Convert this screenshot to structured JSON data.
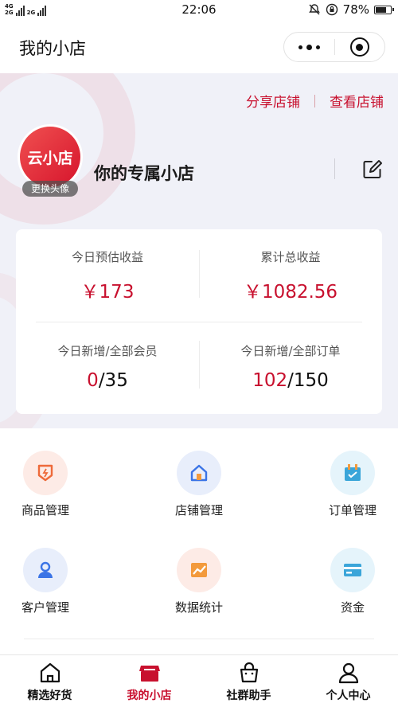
{
  "status_bar": {
    "network_top": "4G",
    "network_bottom": "2G",
    "network_extra": "2G",
    "time": "22:06",
    "battery": "78%",
    "battery_level": 0.78
  },
  "nav": {
    "title": "我的小店"
  },
  "header": {
    "share_store": "分享店铺",
    "view_store": "查看店铺",
    "avatar_text": "云小店",
    "change_avatar": "更换头像",
    "store_name": "你的专属小店"
  },
  "stats": {
    "today_income_label": "今日预估收益",
    "today_income_value": "￥173",
    "total_income_label": "累计总收益",
    "total_income_value": "￥1082.56",
    "members_label": "今日新增/全部会员",
    "members_new": "0",
    "members_total": "/35",
    "orders_label": "今日新增/全部订单",
    "orders_new": "102",
    "orders_total": "/150"
  },
  "menu": {
    "items": [
      {
        "label": "商品管理",
        "icon": "goods-icon"
      },
      {
        "label": "店铺管理",
        "icon": "store-home-icon"
      },
      {
        "label": "订单管理",
        "icon": "order-calendar-icon"
      },
      {
        "label": "客户管理",
        "icon": "customer-icon"
      },
      {
        "label": "数据统计",
        "icon": "chart-icon"
      },
      {
        "label": "资金",
        "icon": "wallet-card-icon"
      }
    ]
  },
  "tabs": [
    {
      "label": "精选好货",
      "icon": "home-icon",
      "active": false
    },
    {
      "label": "我的小店",
      "icon": "shop-icon",
      "active": true
    },
    {
      "label": "社群助手",
      "icon": "bag-icon",
      "active": false
    },
    {
      "label": "个人中心",
      "icon": "person-icon",
      "active": false
    }
  ],
  "colors": {
    "accent": "#c8102e",
    "header_bg": "#f0f1f8"
  }
}
